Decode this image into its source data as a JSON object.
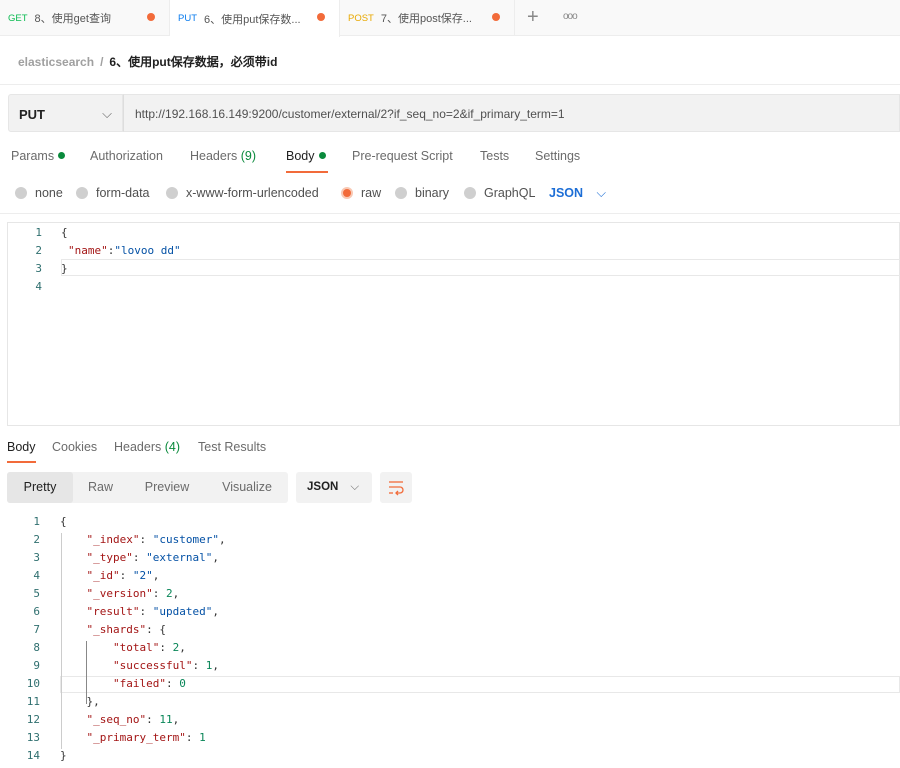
{
  "tabs": [
    {
      "method": "GET",
      "title": "8、使用get查询",
      "color": "#0cbb52"
    },
    {
      "method": "PUT",
      "title": "6、使用put保存数...",
      "color": "#097bed"
    },
    {
      "method": "POST",
      "title": "7、使用post保存...",
      "color": "#ffb400"
    }
  ],
  "tab_actions": {
    "new": "+",
    "more": "ooo"
  },
  "breadcrumb": {
    "collection": "elasticsearch",
    "separator": "/",
    "request": "6、使用put保存数据，必须带id"
  },
  "request": {
    "method": "PUT",
    "url": "http://192.168.16.149:9200/customer/external/2?if_seq_no=2&if_primary_term=1"
  },
  "request_tabs": {
    "params": "Params",
    "authorization": "Authorization",
    "headers": "Headers",
    "headers_count": "(9)",
    "body": "Body",
    "prerequest": "Pre-request Script",
    "tests": "Tests",
    "settings": "Settings",
    "active": "Body"
  },
  "body_options": {
    "none": "none",
    "form_data": "form-data",
    "urlencoded": "x-www-form-urlencoded",
    "raw": "raw",
    "binary": "binary",
    "graphql": "GraphQL",
    "language": "JSON",
    "selected": "raw"
  },
  "request_body": {
    "line_numbers": [
      "1",
      "2",
      "3",
      "4"
    ],
    "line1": "{",
    "key": "\"name\"",
    "colon": ":",
    "value": "\"lovoo dd\"",
    "line3": "}"
  },
  "response_tabs": {
    "body": "Body",
    "cookies": "Cookies",
    "headers": "Headers",
    "headers_count": "(4)",
    "tests": "Test Results",
    "active": "Body"
  },
  "response_view": {
    "pretty": "Pretty",
    "raw": "Raw",
    "preview": "Preview",
    "visualize": "Visualize",
    "format": "JSON",
    "active": "Pretty"
  },
  "response_body": [
    [
      [
        "p",
        "{"
      ]
    ],
    [
      [
        "p",
        "    "
      ],
      [
        "k",
        "\"_index\""
      ],
      [
        "p",
        ": "
      ],
      [
        "sv",
        "\"customer\""
      ],
      [
        "p",
        ","
      ]
    ],
    [
      [
        "p",
        "    "
      ],
      [
        "k",
        "\"_type\""
      ],
      [
        "p",
        ": "
      ],
      [
        "sv",
        "\"external\""
      ],
      [
        "p",
        ","
      ]
    ],
    [
      [
        "p",
        "    "
      ],
      [
        "k",
        "\"_id\""
      ],
      [
        "p",
        ": "
      ],
      [
        "sv",
        "\"2\""
      ],
      [
        "p",
        ","
      ]
    ],
    [
      [
        "p",
        "    "
      ],
      [
        "k",
        "\"_version\""
      ],
      [
        "p",
        ": "
      ],
      [
        "nv",
        "2"
      ],
      [
        "p",
        ","
      ]
    ],
    [
      [
        "p",
        "    "
      ],
      [
        "k",
        "\"result\""
      ],
      [
        "p",
        ": "
      ],
      [
        "sv",
        "\"updated\""
      ],
      [
        "p",
        ","
      ]
    ],
    [
      [
        "p",
        "    "
      ],
      [
        "k",
        "\"_shards\""
      ],
      [
        "p",
        ": {"
      ]
    ],
    [
      [
        "p",
        "        "
      ],
      [
        "k",
        "\"total\""
      ],
      [
        "p",
        ": "
      ],
      [
        "nv",
        "2"
      ],
      [
        "p",
        ","
      ]
    ],
    [
      [
        "p",
        "        "
      ],
      [
        "k",
        "\"successful\""
      ],
      [
        "p",
        ": "
      ],
      [
        "nv",
        "1"
      ],
      [
        "p",
        ","
      ]
    ],
    [
      [
        "p",
        "        "
      ],
      [
        "k",
        "\"failed\""
      ],
      [
        "p",
        ": "
      ],
      [
        "nv",
        "0"
      ]
    ],
    [
      [
        "p",
        "    },"
      ]
    ],
    [
      [
        "p",
        "    "
      ],
      [
        "k",
        "\"_seq_no\""
      ],
      [
        "p",
        ": "
      ],
      [
        "nv",
        "11"
      ],
      [
        "p",
        ","
      ]
    ],
    [
      [
        "p",
        "    "
      ],
      [
        "k",
        "\"_primary_term\""
      ],
      [
        "p",
        ": "
      ],
      [
        "nv",
        "1"
      ]
    ],
    [
      [
        "p",
        "}"
      ]
    ]
  ]
}
